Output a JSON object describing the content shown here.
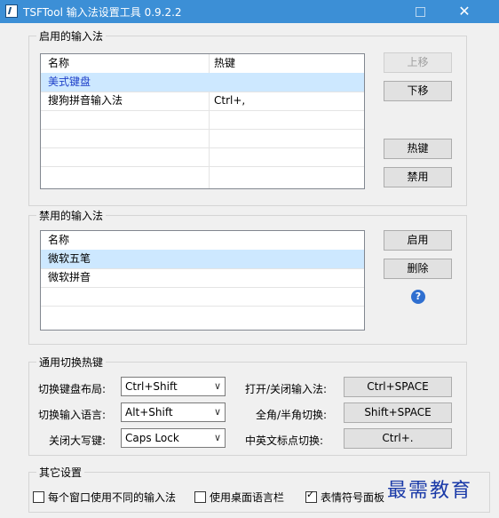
{
  "window": {
    "title": "TSFTool 输入法设置工具 0.9.2.2",
    "maximize_glyph": "",
    "close_glyph": "✕"
  },
  "enabled": {
    "group_title": "启用的输入法",
    "headers": [
      "名称",
      "热键"
    ],
    "rows": [
      {
        "name": "美式键盘",
        "hotkey": ""
      },
      {
        "name": "搜狗拼音输入法",
        "hotkey": "Ctrl+,"
      }
    ],
    "buttons": {
      "up": "上移",
      "down": "下移",
      "hotkey": "热键",
      "disable": "禁用"
    }
  },
  "disabled": {
    "group_title": "禁用的输入法",
    "headers": [
      "名称"
    ],
    "rows": [
      {
        "name": "微软五笔"
      },
      {
        "name": "微软拼音"
      }
    ],
    "buttons": {
      "enable": "启用",
      "delete": "删除"
    },
    "help_glyph": "?"
  },
  "hotkeys": {
    "group_title": "通用切换热键",
    "switch_layout": {
      "label": "切换键盘布局:",
      "value": "Ctrl+Shift"
    },
    "switch_language": {
      "label": "切换输入语言:",
      "value": "Alt+Shift"
    },
    "capslock_off": {
      "label": "关闭大写键:",
      "value": "Caps Lock"
    },
    "toggle_ime": {
      "label": "打开/关闭输入法:",
      "value": "Ctrl+SPACE"
    },
    "full_half": {
      "label": "全角/半角切换:",
      "value": "Shift+SPACE"
    },
    "punct": {
      "label": "中英文标点切换:",
      "value": "Ctrl+."
    },
    "dropdown_glyph": "∨"
  },
  "other": {
    "group_title": "其它设置",
    "per_window": {
      "label": "每个窗口使用不同的输入法",
      "checked": false
    },
    "desktop_langbar": {
      "label": "使用桌面语言栏",
      "checked": false
    },
    "emoji_panel": {
      "label": "表情符号面板",
      "checked": true
    }
  },
  "watermark": "最需教育"
}
